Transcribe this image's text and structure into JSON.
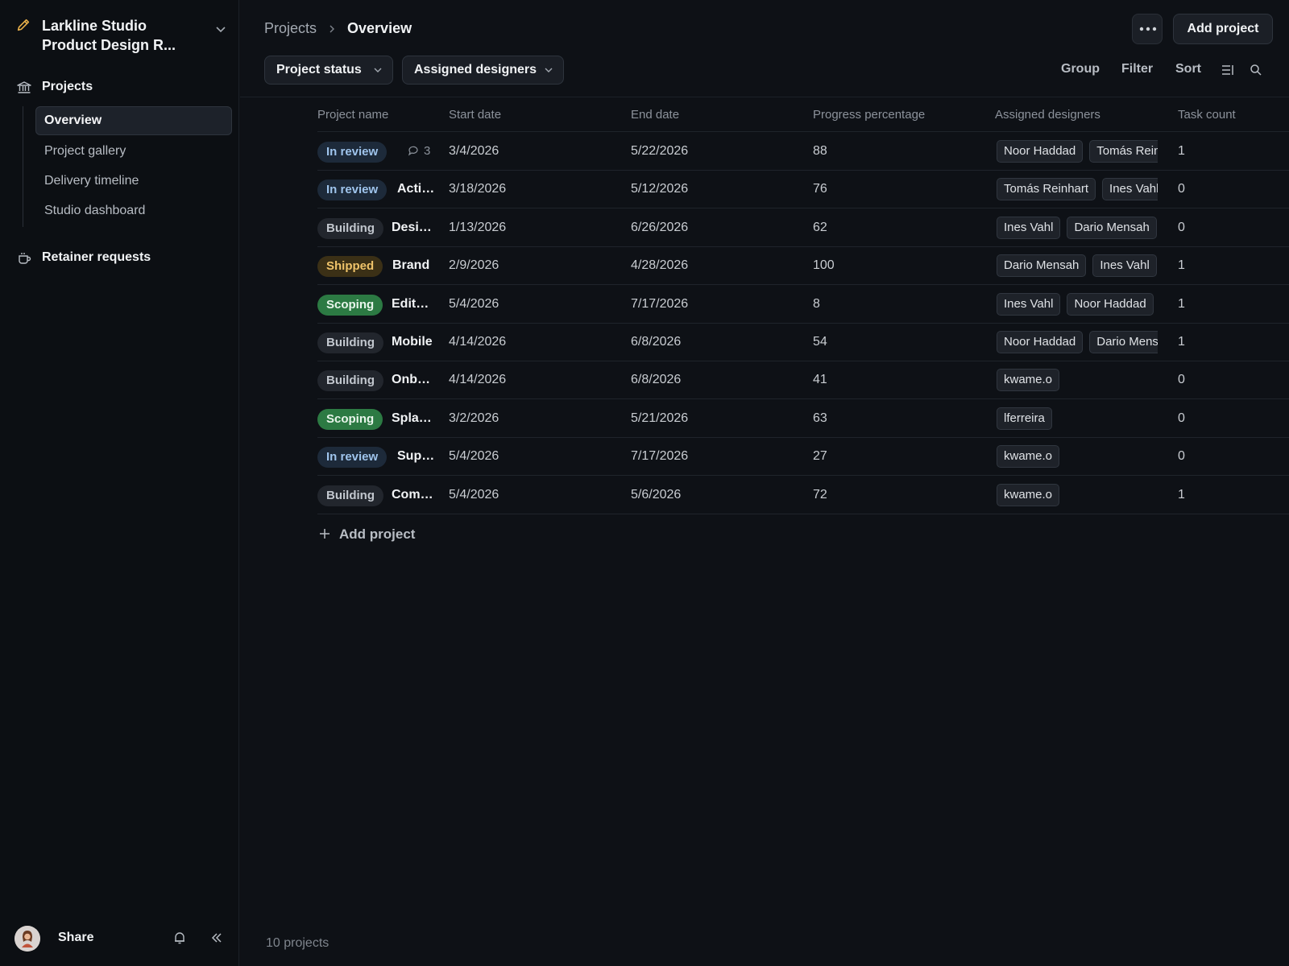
{
  "workspace": {
    "name_line1": "Larkline Studio",
    "name_line2": "Product Design R...",
    "icon": "pencil-icon",
    "accent": "#e8b04a"
  },
  "sidebar": {
    "projects_label": "Projects",
    "items": [
      {
        "label": "Overview",
        "active": true
      },
      {
        "label": "Project gallery"
      },
      {
        "label": "Delivery timeline"
      },
      {
        "label": "Studio dashboard"
      }
    ],
    "retainer_label": "Retainer requests",
    "share_label": "Share"
  },
  "header": {
    "breadcrumb_parent": "Projects",
    "breadcrumb_current": "Overview",
    "add_label": "Add project",
    "filters": [
      "Project status",
      "Assigned designers"
    ],
    "tools": [
      "Group",
      "Filter",
      "Sort"
    ]
  },
  "table": {
    "columns": [
      "Project name",
      "Start date",
      "End date",
      "Progress percentage",
      "Assigned designers",
      "Task count"
    ],
    "rows": [
      {
        "status": "In review",
        "status_key": "review",
        "name": "",
        "comments": "3",
        "start": "3/4/2026",
        "end": "5/22/2026",
        "progress": "88",
        "designers": [
          "Noor Haddad",
          "Tomás Reinhart"
        ],
        "tasks": "1"
      },
      {
        "status": "In review",
        "status_key": "review",
        "name": "Activation",
        "start": "3/18/2026",
        "end": "5/12/2026",
        "progress": "76",
        "designers": [
          "Tomás Reinhart",
          "Ines Vahl"
        ],
        "tasks": "0"
      },
      {
        "status": "Building",
        "status_key": "building",
        "name": "Design",
        "start": "1/13/2026",
        "end": "6/26/2026",
        "progress": "62",
        "designers": [
          "Ines Vahl",
          "Dario Mensah"
        ],
        "tasks": "0"
      },
      {
        "status": "Shipped",
        "status_key": "shipped",
        "name": "Brand",
        "start": "2/9/2026",
        "end": "4/28/2026",
        "progress": "100",
        "designers": [
          "Dario Mensah",
          "Ines Vahl"
        ],
        "tasks": "1"
      },
      {
        "status": "Scoping",
        "status_key": "scoping",
        "name": "Editorial",
        "start": "5/4/2026",
        "end": "7/17/2026",
        "progress": "8",
        "designers": [
          "Ines Vahl",
          "Noor Haddad"
        ],
        "tasks": "1"
      },
      {
        "status": "Building",
        "status_key": "building",
        "name": "Mobile",
        "start": "4/14/2026",
        "end": "6/8/2026",
        "progress": "54",
        "designers": [
          "Noor Haddad",
          "Dario Mensah"
        ],
        "tasks": "1"
      },
      {
        "status": "Building",
        "status_key": "building",
        "name": "Onboarding",
        "start": "4/14/2026",
        "end": "6/8/2026",
        "progress": "41",
        "designers": [
          "kwame.o"
        ],
        "tasks": "0"
      },
      {
        "status": "Scoping",
        "status_key": "scoping",
        "name": "Splash",
        "start": "3/2/2026",
        "end": "5/21/2026",
        "progress": "63",
        "designers": [
          "lferreira"
        ],
        "tasks": "0"
      },
      {
        "status": "In review",
        "status_key": "review",
        "name": "Support",
        "start": "5/4/2026",
        "end": "7/17/2026",
        "progress": "27",
        "designers": [
          "kwame.o"
        ],
        "tasks": "0"
      },
      {
        "status": "Building",
        "status_key": "building",
        "name": "Commerce",
        "start": "5/4/2026",
        "end": "5/6/2026",
        "progress": "72",
        "designers": [
          "kwame.o"
        ],
        "tasks": "1"
      }
    ],
    "add_row_label": "Add project"
  },
  "footer": {
    "count_label": "10 projects"
  }
}
